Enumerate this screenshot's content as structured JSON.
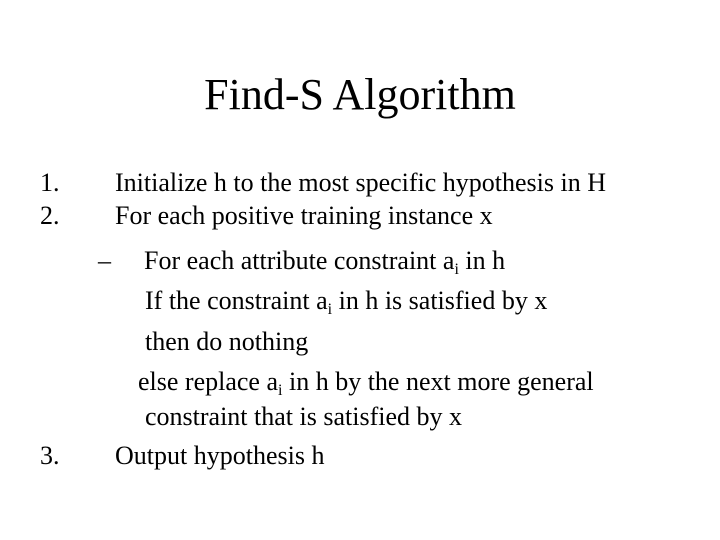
{
  "slide": {
    "title": "Find-S Algorithm",
    "steps": [
      {
        "number": "1.",
        "text": "Initialize h to the most specific hypothesis in H"
      },
      {
        "number": "2.",
        "text": "For each positive training instance x",
        "sub_bullet": {
          "marker": "–",
          "text_pre": "For each attribute constraint a",
          "subscript": "i",
          "text_post": " in h"
        },
        "body_lines": [
          {
            "text_pre": "If the constraint a",
            "subscript": "i",
            "text_post": " in h is satisfied by x"
          },
          {
            "text": "then do nothing"
          },
          {
            "text_pre": "else replace a",
            "subscript": "i",
            "text_post": " in h by the next more general"
          },
          {
            "text": "constraint that is satisfied by x"
          }
        ]
      },
      {
        "number": "3.",
        "text": "Output hypothesis h"
      }
    ]
  }
}
